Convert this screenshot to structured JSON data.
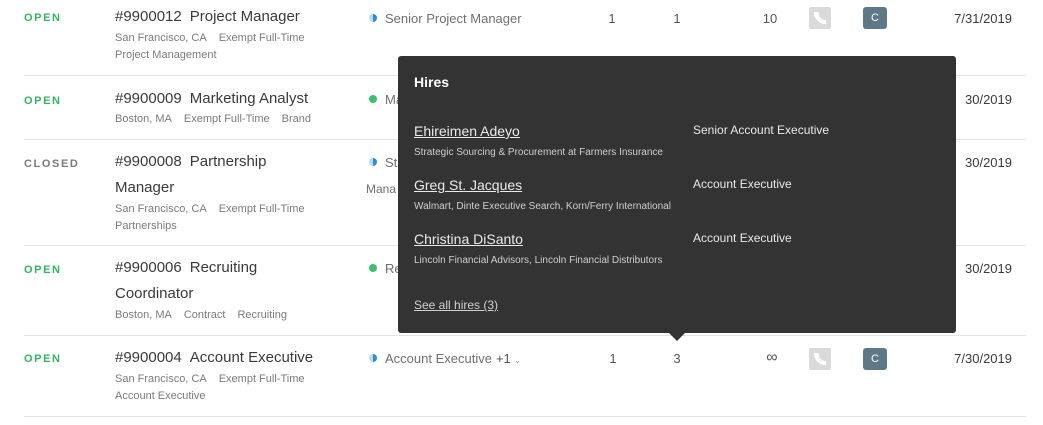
{
  "rows": [
    {
      "status": "OPEN",
      "number": "#9900012",
      "title": "Project Manager",
      "location": "San Francisco, CA",
      "employment": "Exempt Full-Time",
      "department": "Project Management",
      "pipeline": "Senior Project Manager",
      "col1": "1",
      "col2": "1",
      "col3": "10",
      "badge": "C",
      "date": "7/31/2019"
    },
    {
      "status": "OPEN",
      "number": "#9900009",
      "title": "Marketing Analyst",
      "location": "Boston, MA",
      "employment": "Exempt Full-Time",
      "department": "Brand",
      "pipeline": "Ma",
      "date": "30/2019"
    },
    {
      "status": "CLOSED",
      "number": "#9900008",
      "title_line1": "Partnership",
      "title_line2": "Manager",
      "location": "San Francisco, CA",
      "employment": "Exempt Full-Time",
      "department": "Partnerships",
      "pipeline": "St",
      "pipeline_extra": "Mana",
      "date": "30/2019"
    },
    {
      "status": "OPEN",
      "number": "#9900006",
      "title_line1": "Recruiting",
      "title_line2": "Coordinator",
      "location": "Boston, MA",
      "employment": "Contract",
      "department": "Recruiting",
      "pipeline": "Re",
      "date": "30/2019"
    },
    {
      "status": "OPEN",
      "number": "#9900004",
      "title": "Account Executive",
      "location": "San Francisco, CA",
      "employment": "Exempt Full-Time",
      "department": "Account Executive",
      "pipeline": "Account Executive",
      "pipeline_plus": "+1",
      "col1": "1",
      "col2": "3",
      "col3": "∞",
      "badge": "C",
      "date": "7/30/2019"
    }
  ],
  "popover": {
    "title": "Hires",
    "hires": [
      {
        "name": "Ehireimen Adeyo",
        "company": "Strategic Sourcing & Procurement at Farmers Insurance",
        "role": "Senior Account Executive"
      },
      {
        "name": "Greg St. Jacques",
        "company": "Walmart, Dinte Executive Search, Korn/Ferry International",
        "role": "Account Executive"
      },
      {
        "name": "Christina DiSanto",
        "company": "Lincoln Financial Advisors, Lincoln Financial Distributors",
        "role": "Account Executive"
      }
    ],
    "see_all": "See all hires (3)"
  },
  "icons": {
    "pipeline_half": "half-circle-icon",
    "pipeline_dot": "dot-icon",
    "phone": "phone-disabled-icon",
    "chevron": "chevron-down-icon"
  }
}
